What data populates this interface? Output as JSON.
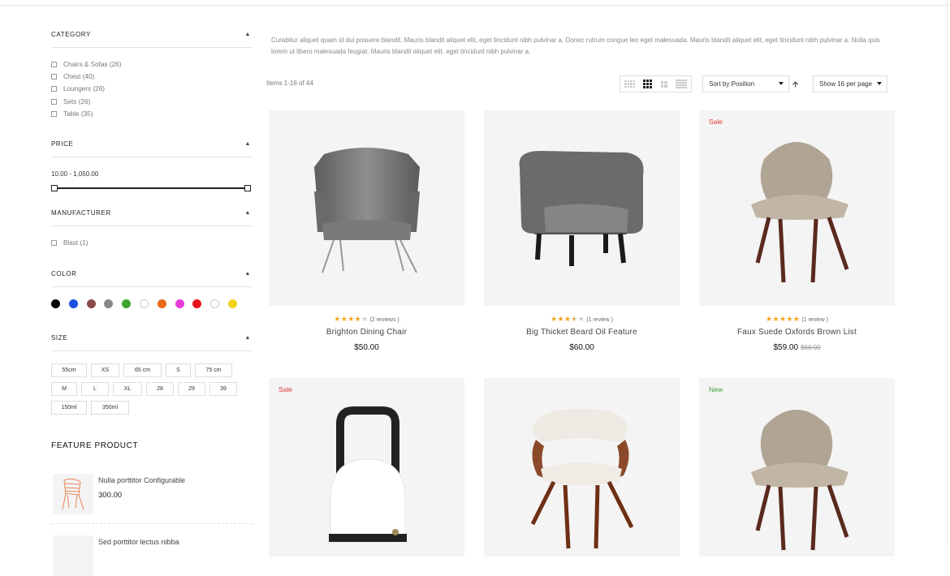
{
  "sidebar": {
    "category": {
      "title": "CATEGORY",
      "items": [
        {
          "label": "Chairs & Sofas",
          "count": "(26)"
        },
        {
          "label": "Chest",
          "count": "(40)"
        },
        {
          "label": "Loungers",
          "count": "(26)"
        },
        {
          "label": "Sets",
          "count": "(26)"
        },
        {
          "label": "Table",
          "count": "(35)"
        }
      ]
    },
    "price": {
      "title": "PRICE",
      "range": "10.00 - 1,050.00"
    },
    "manufacturer": {
      "title": "MANUFACTURER",
      "items": [
        {
          "label": "Blast",
          "count": "(1)"
        }
      ]
    },
    "color": {
      "title": "COLOR",
      "swatches": [
        "#000000",
        "#1a4fe0",
        "#8a4a4a",
        "#888888",
        "#3aa62a",
        "#ffffff",
        "#e8671a",
        "#e83ed8",
        "#e8151c",
        "#ffffff",
        "#f2d21a"
      ]
    },
    "size": {
      "title": "SIZE",
      "rows": [
        [
          "55cm",
          "XS",
          "65 cm",
          "S",
          "75 cm"
        ],
        [
          "M",
          "L",
          "XL",
          "28",
          "29",
          "39"
        ],
        [
          "150ml",
          "350ml"
        ]
      ]
    },
    "feature": {
      "title": "FEATURE PRODUCT",
      "items": [
        {
          "name": "Nulla porttitor Configurable",
          "price": "300.00"
        },
        {
          "name": "Sed porttitor lectus nibba",
          "price": ""
        }
      ]
    }
  },
  "toolbar": {
    "description": "Curabitur aliquet quam id dui posuere blandit. Mauris blandit aliquet elit, eget tincidunt nibh pulvinar a. Donec rutrum congue leo eget malesuada. Mauris blandit aliquet elit, eget tincidunt nibh pulvinar a. Nulla quis lorem ut libero malesuada feugiat. Mauris blandit aliquet elit, eget tincidunt nibh pulvinar a.",
    "items_count": "Items 1-16 of 44",
    "sort_label": "Sort by Position",
    "show_label": "Show 16 per page",
    "sort_dir_icon": "arrow-up-icon"
  },
  "products": [
    {
      "name": "Brighton Dining Chair",
      "price": "$50.00",
      "old_price": "",
      "badge": "",
      "rating": 4,
      "reviews": "(2  reviews )"
    },
    {
      "name": "Big Thicket Beard Oil Feature",
      "price": "$60.00",
      "old_price": "",
      "badge": "",
      "rating": 3.5,
      "reviews": "(1  review )"
    },
    {
      "name": "Faux Suede Oxfords Brown List",
      "price": "$59.00",
      "old_price": "$60.00",
      "badge": "Sale",
      "rating": 5,
      "reviews": "(1  review )"
    },
    {
      "name": "",
      "price": "",
      "old_price": "",
      "badge": "Sale"
    },
    {
      "name": "",
      "price": "",
      "old_price": "",
      "badge": ""
    },
    {
      "name": "",
      "price": "",
      "old_price": "",
      "badge": "New"
    }
  ]
}
